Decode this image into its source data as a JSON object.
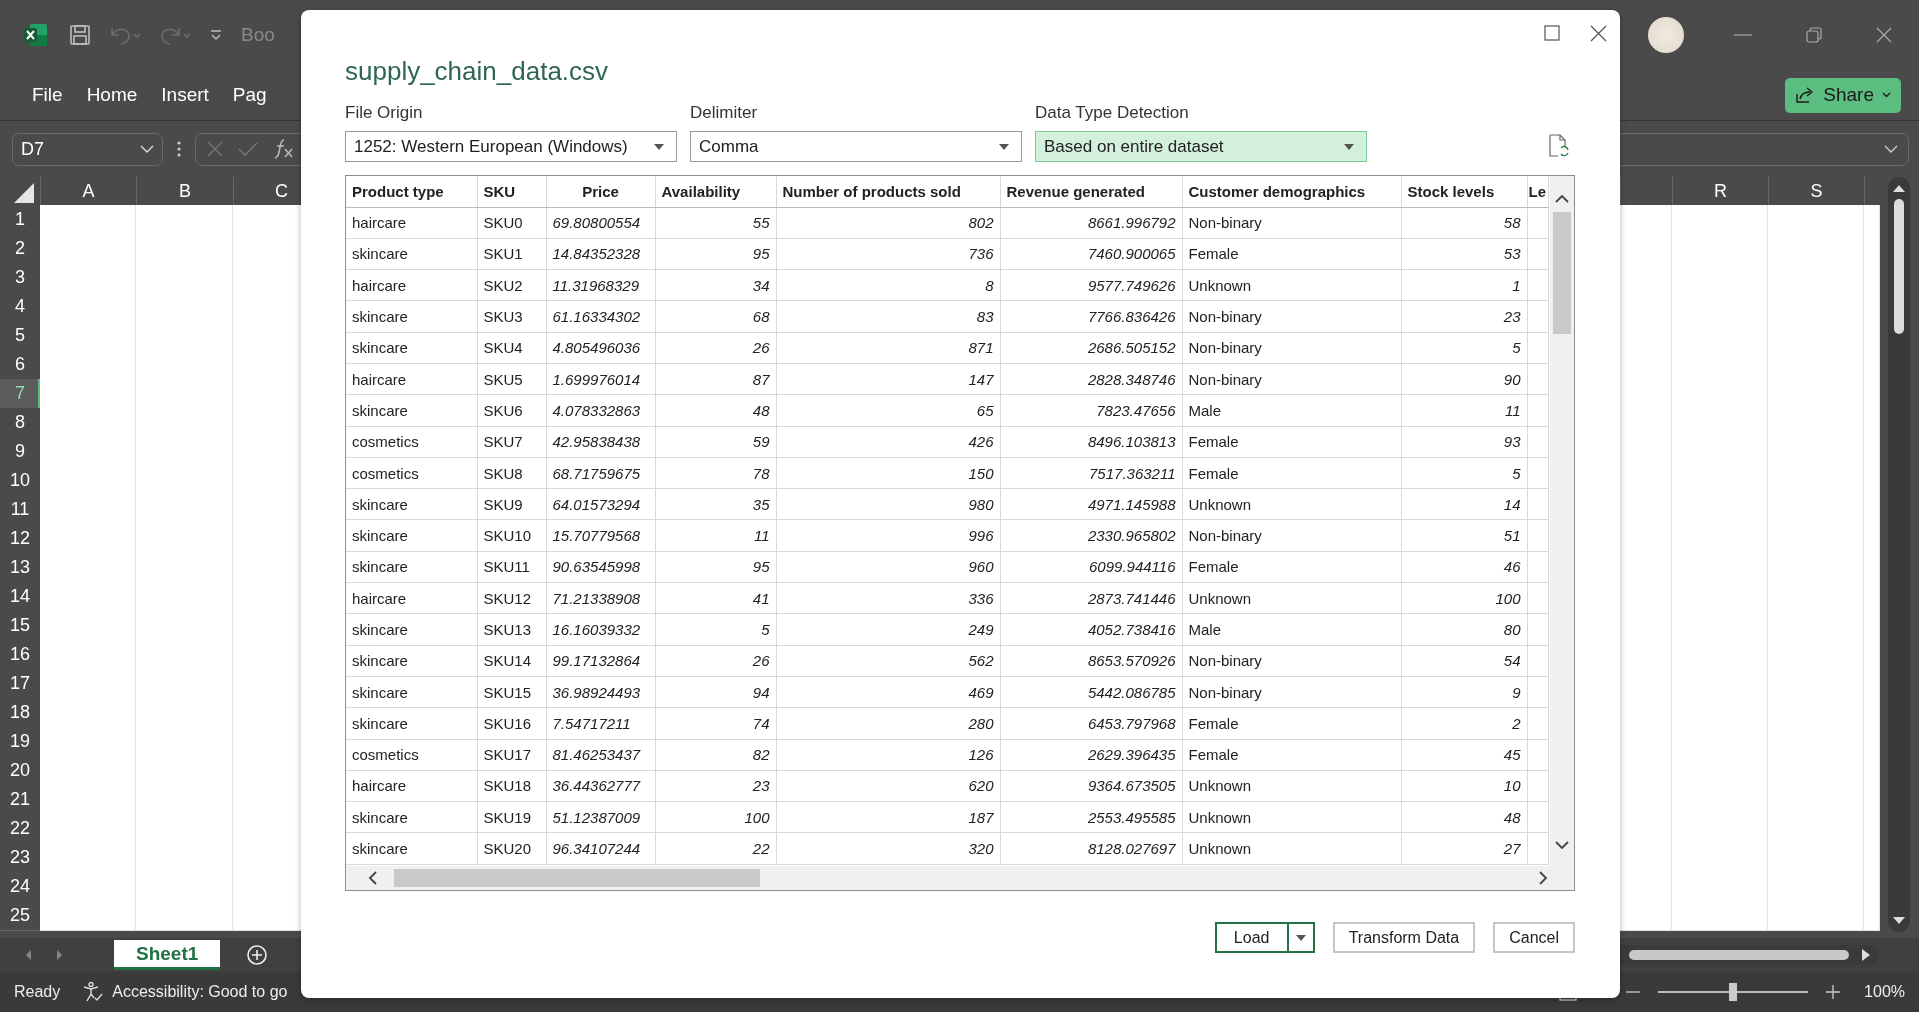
{
  "titlebar": {
    "quick_access": [
      {
        "kind": "save",
        "disabled": false
      },
      {
        "kind": "undo",
        "disabled": true
      },
      {
        "kind": "redo",
        "disabled": true
      },
      {
        "kind": "customize",
        "disabled": false
      }
    ],
    "title": "Boo"
  },
  "ribbon_tabs": [
    "File",
    "Home",
    "Insert",
    "Pag"
  ],
  "share_button": {
    "label": "Share"
  },
  "formula_bar": {
    "name_box": "D7"
  },
  "sheet": {
    "columns": [
      "A",
      "B",
      "C",
      "R",
      "S"
    ],
    "rows": [
      {
        "label": "1",
        "selected": false
      },
      {
        "label": "2",
        "selected": false
      },
      {
        "label": "3",
        "selected": false
      },
      {
        "label": "4",
        "selected": false
      },
      {
        "label": "5",
        "selected": false
      },
      {
        "label": "6",
        "selected": false
      },
      {
        "label": "7",
        "selected": true
      },
      {
        "label": "8",
        "selected": false
      },
      {
        "label": "9",
        "selected": false
      },
      {
        "label": "10",
        "selected": false
      },
      {
        "label": "11",
        "selected": false
      },
      {
        "label": "12",
        "selected": false
      },
      {
        "label": "13",
        "selected": false
      },
      {
        "label": "14",
        "selected": false
      },
      {
        "label": "15",
        "selected": false
      },
      {
        "label": "16",
        "selected": false
      },
      {
        "label": "17",
        "selected": false
      },
      {
        "label": "18",
        "selected": false
      },
      {
        "label": "19",
        "selected": false
      },
      {
        "label": "20",
        "selected": false
      },
      {
        "label": "21",
        "selected": false
      },
      {
        "label": "22",
        "selected": false
      },
      {
        "label": "23",
        "selected": false
      },
      {
        "label": "24",
        "selected": false
      },
      {
        "label": "25",
        "selected": false
      }
    ]
  },
  "sheet_tabs": [
    {
      "label": "Sheet1",
      "selected": true
    }
  ],
  "status_bar": {
    "ready": "Ready",
    "accessibility": "Accessibility: Good to go",
    "zoom": "100%",
    "zoom_level": {
      "level": 0.5
    }
  },
  "dialog": {
    "title": "supply_chain_data.csv",
    "fields": [
      {
        "label": "File Origin",
        "value": "1252: Western European (Windows)",
        "highlighted": false
      },
      {
        "label": "Delimiter",
        "value": "Comma",
        "highlighted": false
      },
      {
        "label": "Data Type Detection",
        "value": "Based on entire dataset",
        "highlighted": true
      }
    ],
    "table": {
      "columns": [
        {
          "label": "Product type",
          "kind": "text"
        },
        {
          "label": "SKU",
          "kind": "text"
        },
        {
          "label": "Price",
          "kind": "decimal"
        },
        {
          "label": "Availability",
          "kind": "number"
        },
        {
          "label": "Number of products sold",
          "kind": "number"
        },
        {
          "label": "Revenue generated",
          "kind": "number"
        },
        {
          "label": "Customer demographics",
          "kind": "text"
        },
        {
          "label": "Stock levels",
          "kind": "number"
        },
        {
          "label": "Le",
          "kind": "text"
        }
      ],
      "rows": [
        [
          "haircare",
          "SKU0",
          "69.80800554",
          "55",
          "802",
          "8661.996792",
          "Non-binary",
          "58"
        ],
        [
          "skincare",
          "SKU1",
          "14.84352328",
          "95",
          "736",
          "7460.900065",
          "Female",
          "53"
        ],
        [
          "haircare",
          "SKU2",
          "11.31968329",
          "34",
          "8",
          "9577.749626",
          "Unknown",
          "1"
        ],
        [
          "skincare",
          "SKU3",
          "61.16334302",
          "68",
          "83",
          "7766.836426",
          "Non-binary",
          "23"
        ],
        [
          "skincare",
          "SKU4",
          "4.805496036",
          "26",
          "871",
          "2686.505152",
          "Non-binary",
          "5"
        ],
        [
          "haircare",
          "SKU5",
          "1.699976014",
          "87",
          "147",
          "2828.348746",
          "Non-binary",
          "90"
        ],
        [
          "skincare",
          "SKU6",
          "4.078332863",
          "48",
          "65",
          "7823.47656",
          "Male",
          "11"
        ],
        [
          "cosmetics",
          "SKU7",
          "42.95838438",
          "59",
          "426",
          "8496.103813",
          "Female",
          "93"
        ],
        [
          "cosmetics",
          "SKU8",
          "68.71759675",
          "78",
          "150",
          "7517.363211",
          "Female",
          "5"
        ],
        [
          "skincare",
          "SKU9",
          "64.01573294",
          "35",
          "980",
          "4971.145988",
          "Unknown",
          "14"
        ],
        [
          "skincare",
          "SKU10",
          "15.70779568",
          "11",
          "996",
          "2330.965802",
          "Non-binary",
          "51"
        ],
        [
          "skincare",
          "SKU11",
          "90.63545998",
          "95",
          "960",
          "6099.944116",
          "Female",
          "46"
        ],
        [
          "haircare",
          "SKU12",
          "71.21338908",
          "41",
          "336",
          "2873.741446",
          "Unknown",
          "100"
        ],
        [
          "skincare",
          "SKU13",
          "16.16039332",
          "5",
          "249",
          "4052.738416",
          "Male",
          "80"
        ],
        [
          "skincare",
          "SKU14",
          "99.17132864",
          "26",
          "562",
          "8653.570926",
          "Non-binary",
          "54"
        ],
        [
          "skincare",
          "SKU15",
          "36.98924493",
          "94",
          "469",
          "5442.086785",
          "Non-binary",
          "9"
        ],
        [
          "skincare",
          "SKU16",
          "7.54717211",
          "74",
          "280",
          "6453.797968",
          "Female",
          "2"
        ],
        [
          "cosmetics",
          "SKU17",
          "81.46253437",
          "82",
          "126",
          "2629.396435",
          "Female",
          "45"
        ],
        [
          "haircare",
          "SKU18",
          "36.44362777",
          "23",
          "620",
          "9364.673505",
          "Unknown",
          "10"
        ],
        [
          "skincare",
          "SKU19",
          "51.12387009",
          "100",
          "187",
          "2553.495585",
          "Unknown",
          "48"
        ],
        [
          "skincare",
          "SKU20",
          "96.34107244",
          "22",
          "320",
          "8128.027697",
          "Unknown",
          "27"
        ]
      ]
    },
    "buttons": [
      {
        "label": "Load",
        "default": true
      },
      {
        "label": "Transform Data",
        "default": false
      },
      {
        "label": "Cancel",
        "default": false
      }
    ]
  }
}
